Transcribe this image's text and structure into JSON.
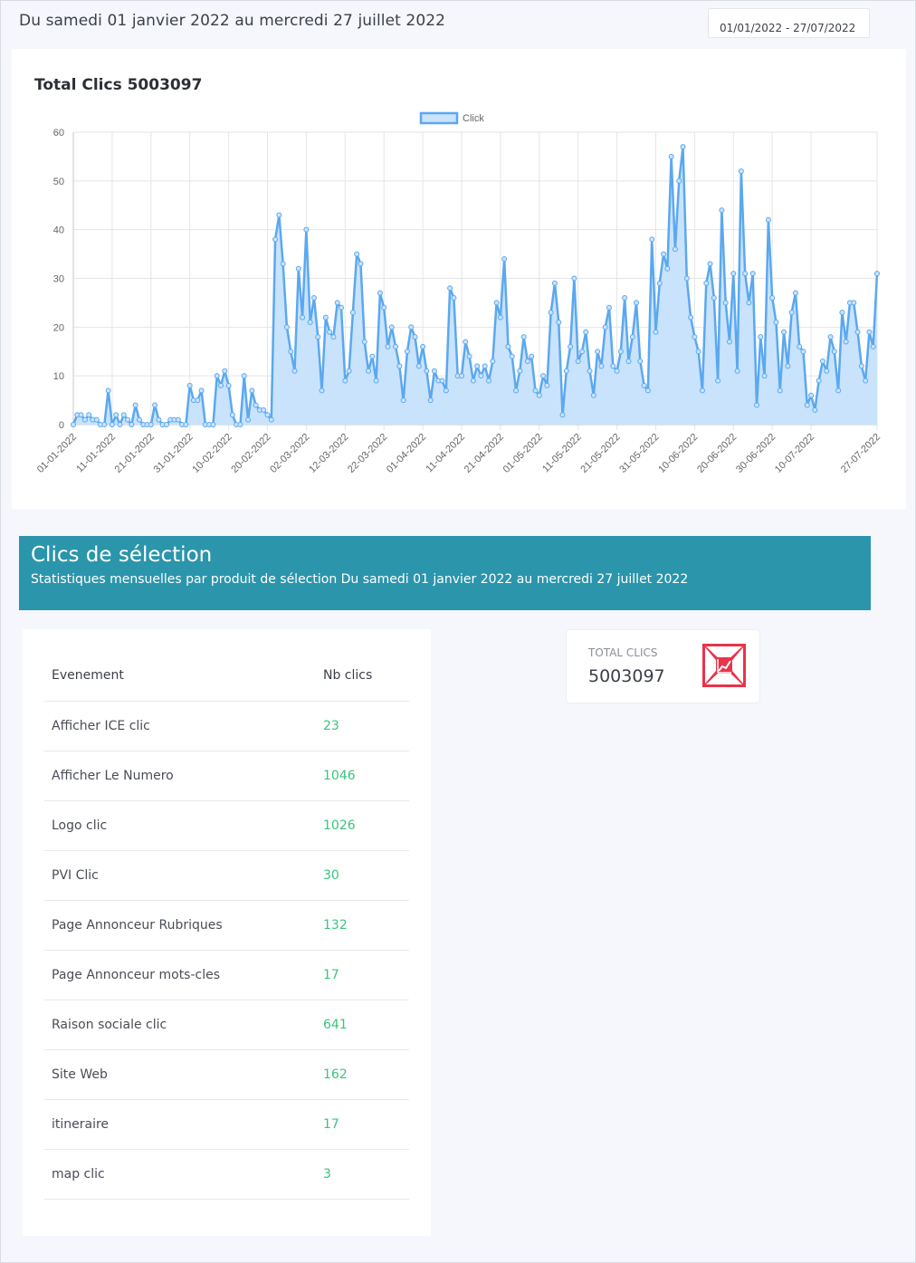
{
  "header": {
    "range_title": "Du samedi 01 janvier 2022 au mercredi 27 juillet 2022",
    "date_input_value": "01/01/2022 - 27/07/2022"
  },
  "chart_card": {
    "title": "Total Clics 5003097"
  },
  "chart_data": {
    "type": "area",
    "title": "Total Clics 5003097",
    "legend": [
      "Click"
    ],
    "legend_position": "top",
    "fill_color": "#c9e3fc",
    "line_color": "#5ba8f0",
    "ylim": [
      0,
      60
    ],
    "yticks": [
      0,
      10,
      20,
      30,
      40,
      50,
      60
    ],
    "xtick_labels": [
      "01-01-2022",
      "11-01-2022",
      "21-01-2022",
      "31-01-2022",
      "10-02-2022",
      "20-02-2022",
      "02-03-2022",
      "12-03-2022",
      "22-03-2022",
      "01-04-2022",
      "11-04-2022",
      "21-04-2022",
      "01-05-2022",
      "11-05-2022",
      "21-05-2022",
      "31-05-2022",
      "10-06-2022",
      "20-06-2022",
      "30-06-2022",
      "10-07-2022",
      "27-07-2022"
    ],
    "series": [
      {
        "name": "Click",
        "values": [
          0,
          2,
          2,
          1,
          2,
          1,
          1,
          0,
          0,
          7,
          0,
          2,
          0,
          2,
          1,
          0,
          4,
          1,
          0,
          0,
          0,
          4,
          1,
          0,
          0,
          1,
          1,
          1,
          0,
          0,
          8,
          5,
          5,
          7,
          0,
          0,
          0,
          10,
          8,
          11,
          8,
          2,
          0,
          0,
          10,
          1,
          7,
          4,
          3,
          3,
          2,
          1,
          38,
          43,
          33,
          20,
          15,
          11,
          32,
          22,
          40,
          21,
          26,
          18,
          7,
          22,
          19,
          18,
          25,
          24,
          9,
          11,
          23,
          35,
          33,
          17,
          11,
          14,
          9,
          27,
          24,
          16,
          20,
          16,
          12,
          5,
          15,
          20,
          18,
          12,
          16,
          11,
          5,
          11,
          9,
          9,
          7,
          28,
          26,
          10,
          10,
          17,
          14,
          9,
          12,
          10,
          12,
          9,
          13,
          25,
          22,
          34,
          16,
          14,
          7,
          11,
          18,
          13,
          14,
          7,
          6,
          10,
          8,
          23,
          29,
          21,
          2,
          11,
          16,
          30,
          13,
          15,
          19,
          11,
          6,
          15,
          12,
          20,
          24,
          12,
          11,
          15,
          26,
          13,
          18,
          25,
          13,
          8,
          7,
          38,
          19,
          29,
          35,
          32,
          55,
          36,
          50,
          57,
          30,
          22,
          18,
          15,
          7,
          29,
          33,
          26,
          9,
          44,
          25,
          17,
          31,
          11,
          52,
          31,
          25,
          31,
          4,
          18,
          10,
          42,
          26,
          21,
          7,
          19,
          12,
          23,
          27,
          16,
          15,
          4,
          6,
          3,
          9,
          13,
          11,
          18,
          15,
          7,
          23,
          17,
          25,
          25,
          19,
          12,
          9,
          19,
          16,
          31
        ]
      }
    ]
  },
  "selection": {
    "title": "Clics de sélection",
    "subtitle": "Statistiques mensuelles par produit de sélection Du samedi 01 janvier 2022 au mercredi 27 juillet 2022"
  },
  "events_table": {
    "headers": [
      "Evenement",
      "Nb clics"
    ],
    "rows": [
      {
        "event": "Afficher ICE clic",
        "count": "23"
      },
      {
        "event": "Afficher Le Numero",
        "count": "1046"
      },
      {
        "event": "Logo clic",
        "count": "1026"
      },
      {
        "event": "PVI Clic",
        "count": "30"
      },
      {
        "event": "Page Annonceur Rubriques",
        "count": "132"
      },
      {
        "event": "Page Annonceur mots-cles",
        "count": "17"
      },
      {
        "event": "Raison sociale clic",
        "count": "641"
      },
      {
        "event": "Site Web",
        "count": "162"
      },
      {
        "event": "itineraire",
        "count": "17"
      },
      {
        "event": "map clic",
        "count": "3"
      }
    ]
  },
  "total_card": {
    "label": "TOTAL CLICS",
    "value": "5003097",
    "icon": "chart-growth-icon",
    "icon_color": "#e8334a"
  }
}
